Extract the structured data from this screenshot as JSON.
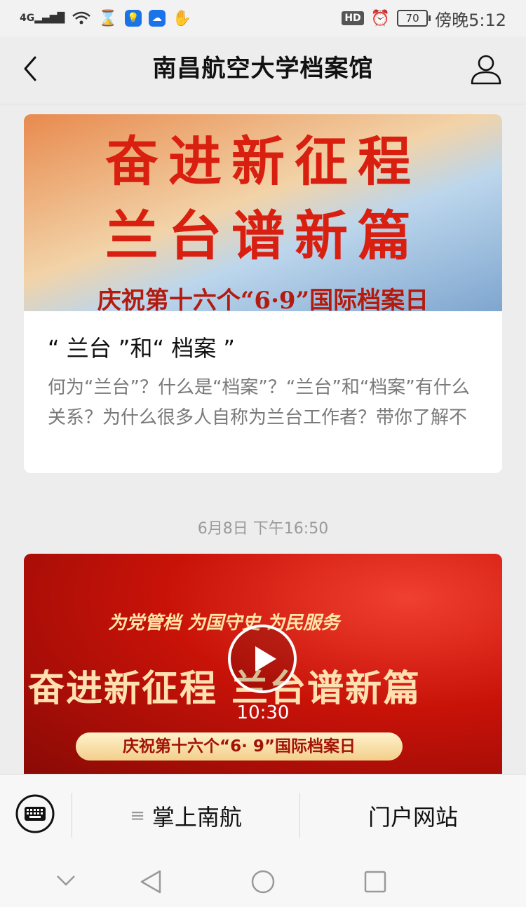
{
  "status": {
    "network": "4G",
    "battery": "70",
    "hd": "HD",
    "time": "傍晚5:12"
  },
  "nav": {
    "title": "南昌航空大学档案馆"
  },
  "article1": {
    "banner_line1": "奋进新征程",
    "banner_line2": "兰台谱新篇",
    "banner_sub": "庆祝第十六个“6·9”国际档案日",
    "title": "“ 兰台 ”和“ 档案 ”",
    "desc": "何为“兰台”？什么是“档案”？“兰台”和“档案”有什么关系？为什么很多人自称为兰台工作者？带你了解不"
  },
  "date_label": "6月8日 下午16:50",
  "video1": {
    "slogan": "为党管档  为国守史  为民服务",
    "main": "奋进新征程  兰台谱新篇",
    "ribbon": "庆祝第十六个“6· 9”国际档案日",
    "duration": "10:30"
  },
  "menu": {
    "item1": "掌上南航",
    "item1_icon": "≡",
    "item2": "门户网站"
  },
  "colors": {
    "accent_red": "#d91f10",
    "background": "#ededed"
  }
}
